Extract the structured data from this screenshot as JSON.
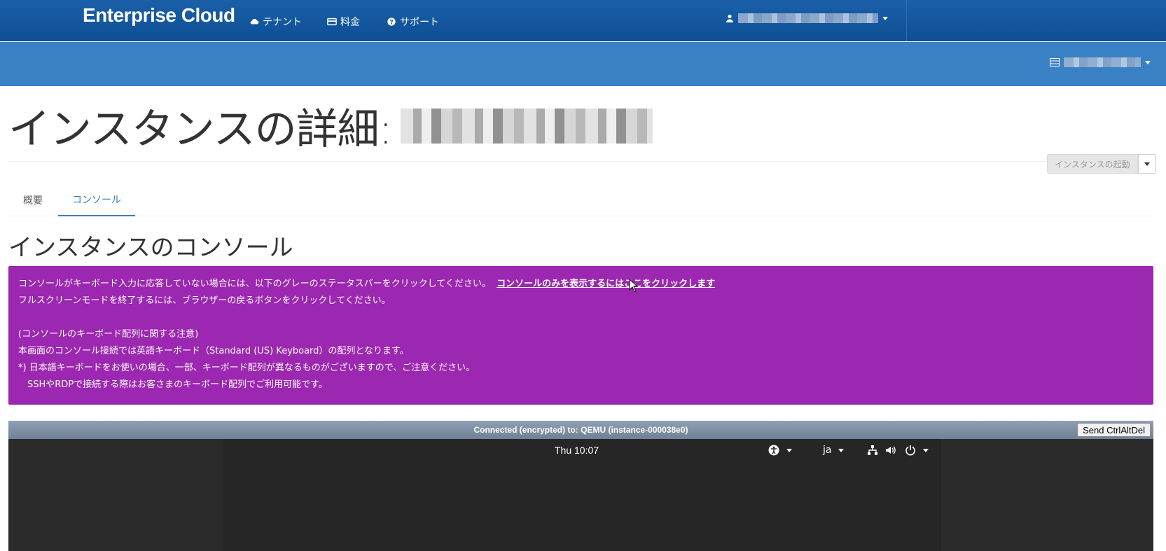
{
  "app": {
    "brand": "Enterprise Cloud"
  },
  "nav": {
    "items": [
      {
        "label": "テナント",
        "icon": "cloud-icon"
      },
      {
        "label": "料金",
        "icon": "credit-card-icon"
      },
      {
        "label": "サポート",
        "icon": "question-circle-icon"
      }
    ],
    "user_icon": "user-icon"
  },
  "subbar": {
    "project_icon": "server-icon"
  },
  "page": {
    "title_prefix": "インスタンスの詳細:",
    "launch_button": "インスタンスの起動"
  },
  "tabs": [
    {
      "label": "概要",
      "active": false
    },
    {
      "label": "コンソール",
      "active": true
    }
  ],
  "section": {
    "title": "インスタンスのコンソール"
  },
  "alert": {
    "line1": "コンソールがキーボード入力に応答していない場合には、以下のグレーのステータスバーをクリックしてください。",
    "line1_link": "コンソールのみを表示するにはここをクリックします",
    "line2": "フルスクリーンモードを終了するには、ブラウザーの戻るボタンをクリックしてください。",
    "line3": "(コンソールのキーボード配列に関する注意)",
    "line4": "本画面のコンソール接続では英語キーボード（Standard (US) Keyboard）の配列となります。",
    "line5": "*) 日本語キーボードをお使いの場合、一部、キーボード配列が異なるものがございますので、ご注意ください。",
    "line6": "　SSHやRDPで接続する際はお客さまのキーボード配列でご利用可能です。",
    "color": "#9c27b0"
  },
  "console": {
    "status": "Connected (encrypted) to: QEMU (instance-000038e0)",
    "send_button": "Send CtrlAltDel",
    "clock": "Thu 10:07",
    "language": "ja",
    "icons": [
      "accessibility-icon",
      "network-icon",
      "volume-icon",
      "power-icon"
    ]
  },
  "colors": {
    "navbar": "#0e4f95",
    "subbar": "#3a80c4",
    "link": "#337ab7"
  }
}
